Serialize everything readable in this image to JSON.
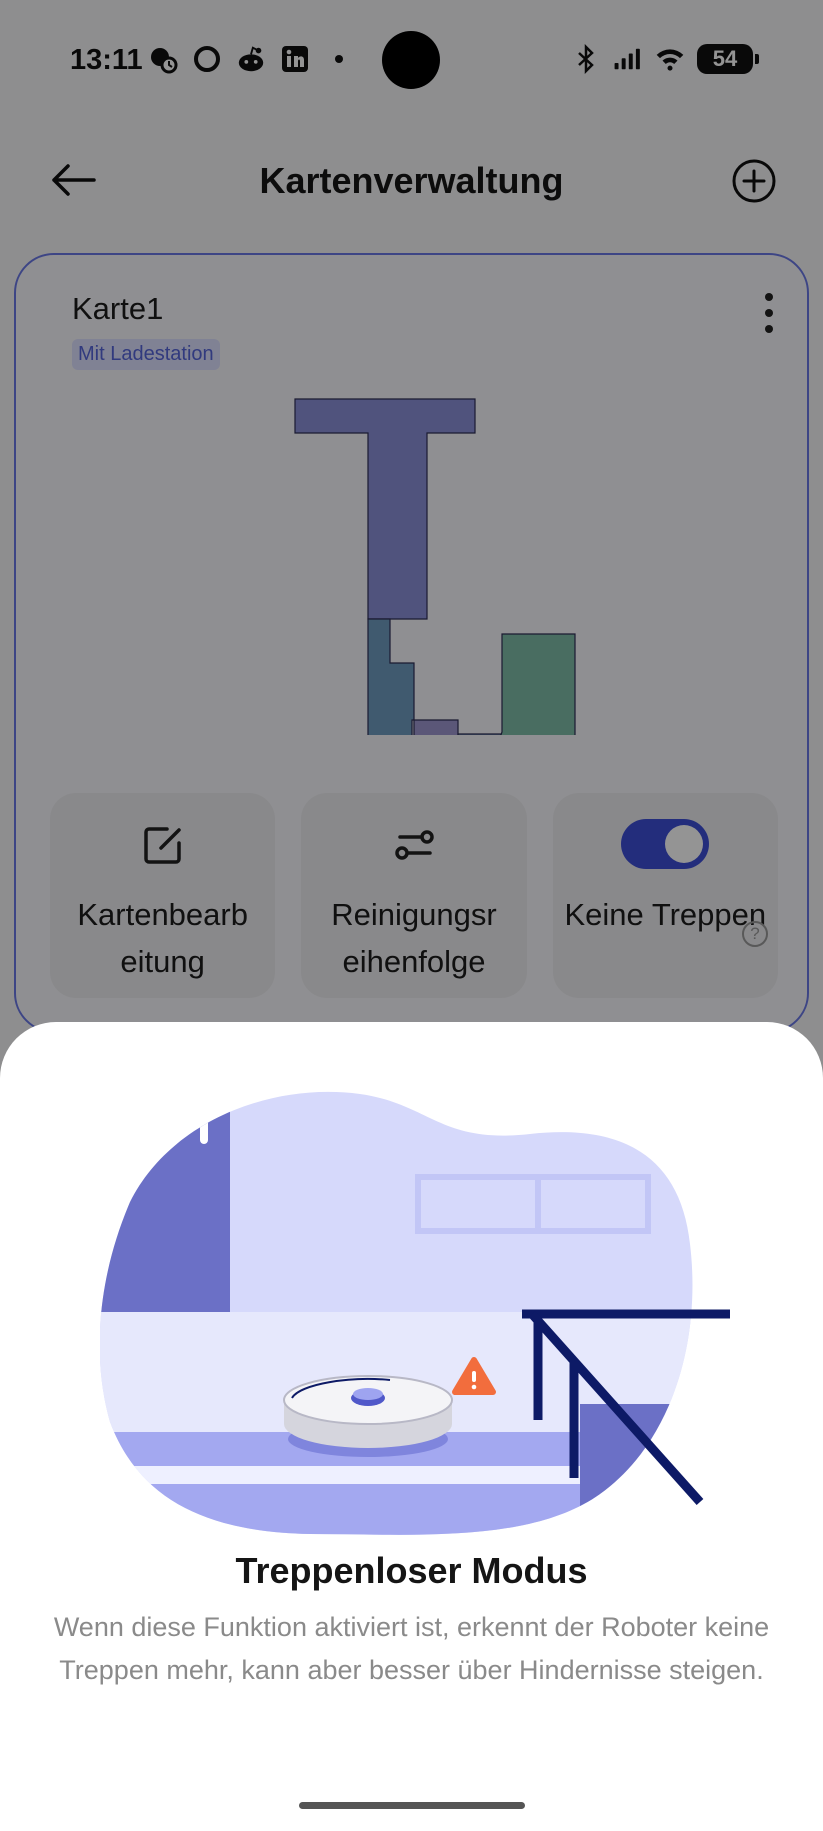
{
  "status": {
    "time": "13:11",
    "battery": "54",
    "left_icons": [
      "hand-clock-icon",
      "ring-icon",
      "reddit-icon",
      "linkedin-icon",
      "dot-icon"
    ],
    "right_icons": [
      "bluetooth-icon",
      "signal-icon",
      "wifi-icon"
    ]
  },
  "header": {
    "title": "Kartenverwaltung"
  },
  "card": {
    "name": "Karte1",
    "badge": "Mit Ladestation",
    "actions": [
      {
        "label": "Kartenbearb eitung",
        "icon": "edit-icon"
      },
      {
        "label": "Reinigungsr eihenfolge",
        "icon": "sequence-icon"
      },
      {
        "label": "Keine Treppen",
        "toggle_on": true,
        "help": "?"
      }
    ]
  },
  "sheet": {
    "title": "Treppenloser Modus",
    "description": "Wenn diese Funktion aktiviert ist, erkennt der Roboter keine Treppen mehr, kann aber besser über Hindernisse steigen."
  },
  "colors": {
    "accent": "#3d4fd6",
    "warning": "#f26d3d",
    "illus_dark": "#6b70c6",
    "illus_light": "#d6d9fb",
    "stair_line": "#0d1a66"
  }
}
